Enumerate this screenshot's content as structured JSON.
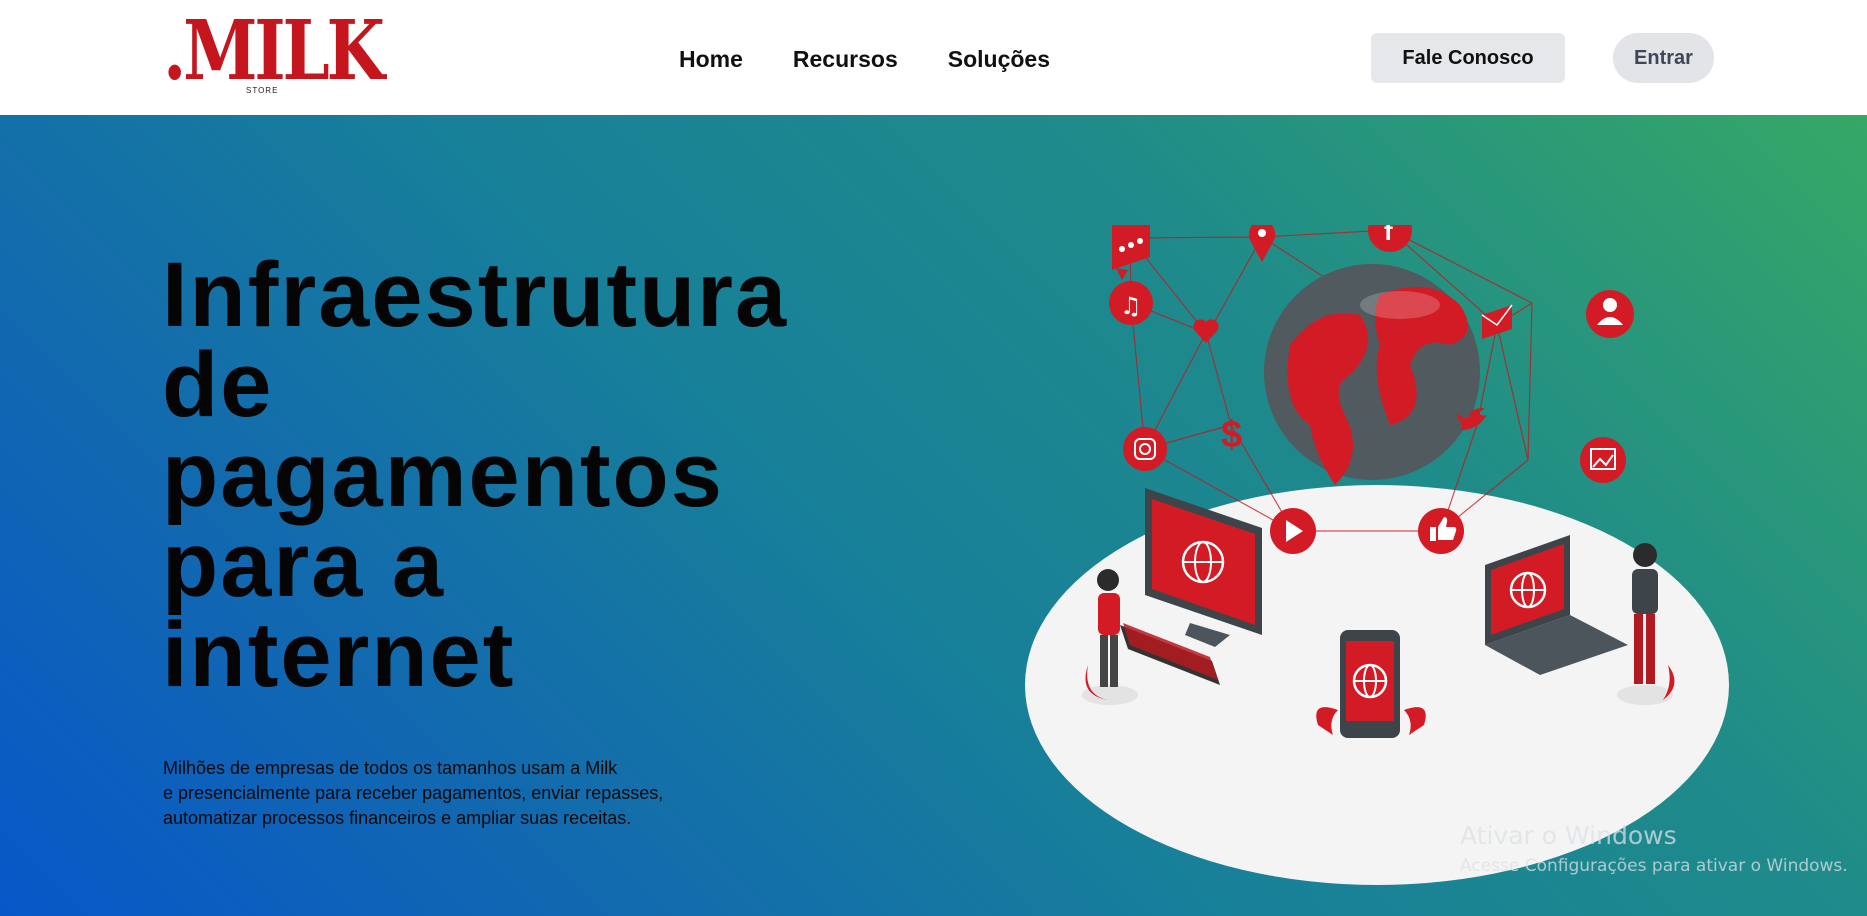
{
  "brand": {
    "logo_text": ".MILK",
    "logo_sub": "STORE"
  },
  "nav": {
    "items": [
      {
        "label": "Home"
      },
      {
        "label": "Recursos"
      },
      {
        "label": "Soluções"
      }
    ]
  },
  "actions": {
    "contact_label": "Fale Conosco",
    "login_label": "Entrar"
  },
  "hero": {
    "title_lines": [
      "Infraestrutura",
      "de",
      "pagamentos",
      "para a",
      "internet"
    ],
    "description_lines": [
      "Milhões de empresas de todos os tamanhos usam a Milk",
      "e presencialmente para receber pagamentos, enviar repasses,",
      "automatizar processos financeiros e ampliar suas receitas."
    ]
  },
  "watermark": {
    "title": "Ativar o Windows",
    "subtitle": "Acesse Configurações para ativar o Windows."
  },
  "colors": {
    "brand_red": "#c4161c",
    "gradient_start": "#0757c9",
    "gradient_end": "#35a866",
    "button_gray": "#e6e7eb"
  },
  "icons": [
    "chat-icon",
    "location-pin-icon",
    "facebook-icon",
    "music-icon",
    "heart-icon",
    "mail-icon",
    "user-icon",
    "globe-icon",
    "instagram-icon",
    "dollar-icon",
    "twitter-icon",
    "image-icon",
    "play-icon",
    "thumbs-up-icon"
  ]
}
